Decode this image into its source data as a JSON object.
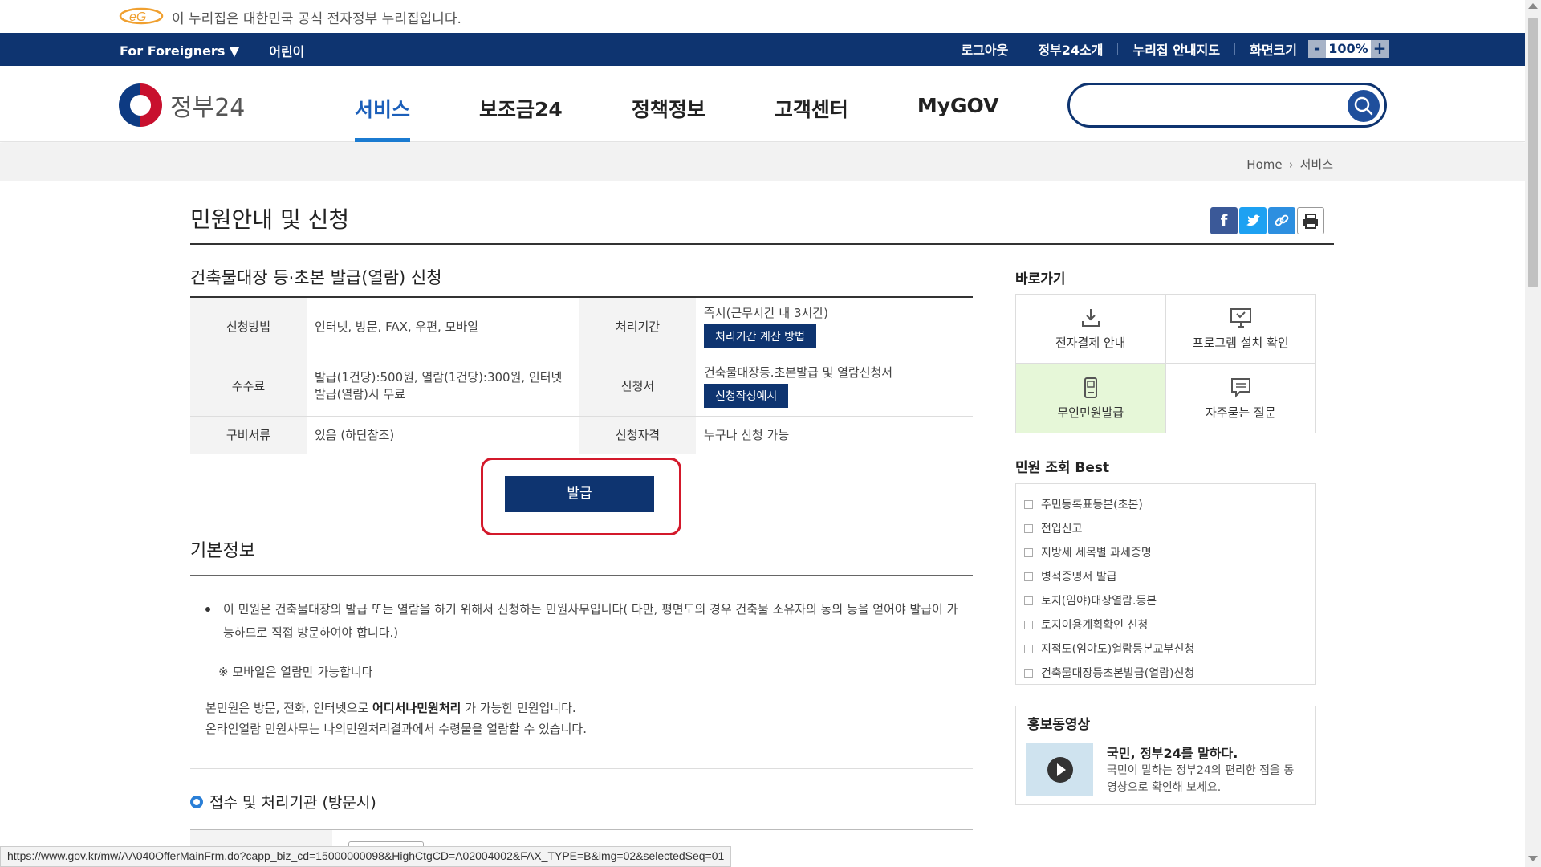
{
  "banner": {
    "text": "이 누리집은 대한민국 공식 전자정부 누리집입니다."
  },
  "util": {
    "foreigners": "For Foreigners ▼",
    "kids": "어린이",
    "logout": "로그아웃",
    "about": "정부24소개",
    "sitemap": "누리집 안내지도",
    "zoom_label": "화면크기",
    "zoom_minus": "-",
    "zoom_value": "100%",
    "zoom_plus": "+"
  },
  "header": {
    "logo_text": "정부24",
    "nav": [
      "서비스",
      "보조금24",
      "정책정보",
      "고객센터",
      "MyGOV"
    ],
    "search_placeholder": ""
  },
  "breadcrumb": {
    "home": "Home",
    "current": "서비스"
  },
  "page": {
    "title": "민원안내 및 신청"
  },
  "service": {
    "title": "건축물대장 등·초본 발급(열람) 신청",
    "rows": [
      {
        "h1": "신청방법",
        "v1": "인터넷, 방문, FAX, 우편, 모바일",
        "h2": "처리기간",
        "v2": "즉시(근무시간 내 3시간)",
        "btn": "처리기간 계산 방법"
      },
      {
        "h1": "수수료",
        "v1": "발급(1건당):500원, 열람(1건당):300원, 인터넷 발급(열람)시 무료",
        "h2": "신청서",
        "v2": "건축물대장등.초본발급 및 열람신청서",
        "btn": "신청작성예시"
      },
      {
        "h1": "구비서류",
        "v1": "있음 (하단참조)",
        "h2": "신청자격",
        "v2": "누구나 신청 가능",
        "btn": ""
      }
    ],
    "issue_button": "발급"
  },
  "basic": {
    "title": "기본정보",
    "bullet": "이 민원은 건축물대장의 발급 또는 열람을 하기 위해서 신청하는 민원사무입니다( 다만, 평면도의 경우 건축물 소유자의 동의 등을 얻어야 발급이 가능하므로 직접 방문하여야 합니다.)",
    "note": "※ 모바일은 열람만 가능합니다",
    "para1_pre": "본민원은 방문, 전화, 인터넷으로 ",
    "para1_bold": "어디서나민원처리",
    "para1_post": " 가 가능한 민원입니다.",
    "para2": "온라인열람 민원사무는 나의민원처리결과에서 수령물을 열람할 수 있습니다.",
    "sub_heading": "접수 및 처리기관 (방문시)"
  },
  "sidebar": {
    "quick_title": "바로가기",
    "quick": [
      {
        "label": "전자결제 안내",
        "icon": "download-icon"
      },
      {
        "label": "프로그램 설치 확인",
        "icon": "monitor-icon"
      },
      {
        "label": "무인민원발급",
        "icon": "kiosk-icon"
      },
      {
        "label": "자주묻는 질문",
        "icon": "chat-icon"
      }
    ],
    "best_title": "민원 조회 Best",
    "best": [
      "주민등록표등본(초본)",
      "전입신고",
      "지방세 세목별 과세증명",
      "병적증명서 발급",
      "토지(임야)대장열람.등본",
      "토지이용계획확인 신청",
      "지적도(임야도)열람등본교부신청",
      "건축물대장등초본발급(열람)신청"
    ],
    "promo_title": "홍보동영상",
    "promo_head": "국민, 정부24를 말하다.",
    "promo_desc": "국민이 말하는 정부24의 편리한 점을 동영상으로 확인해 보세요."
  },
  "status_url": "https://www.gov.kr/mw/AA040OfferMainFrm.do?capp_biz_cd=15000000098&HighCtgCD=A02004002&FAX_TYPE=B&img=02&selectedSeq=01",
  "colors": {
    "navy": "#0e3470",
    "accent": "#1b7bd1",
    "highlight": "#d3192b"
  }
}
